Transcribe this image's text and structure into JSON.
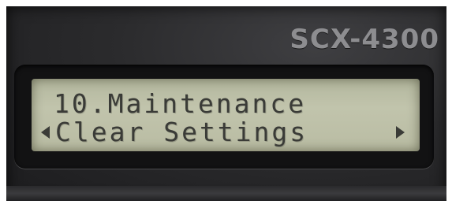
{
  "device": {
    "model": "SCX-4300"
  },
  "lcd": {
    "line1": "10.Maintenance",
    "line2": "Clear Settings",
    "left_arrow_icon": "triangle-left",
    "right_arrow_icon": "triangle-right"
  }
}
